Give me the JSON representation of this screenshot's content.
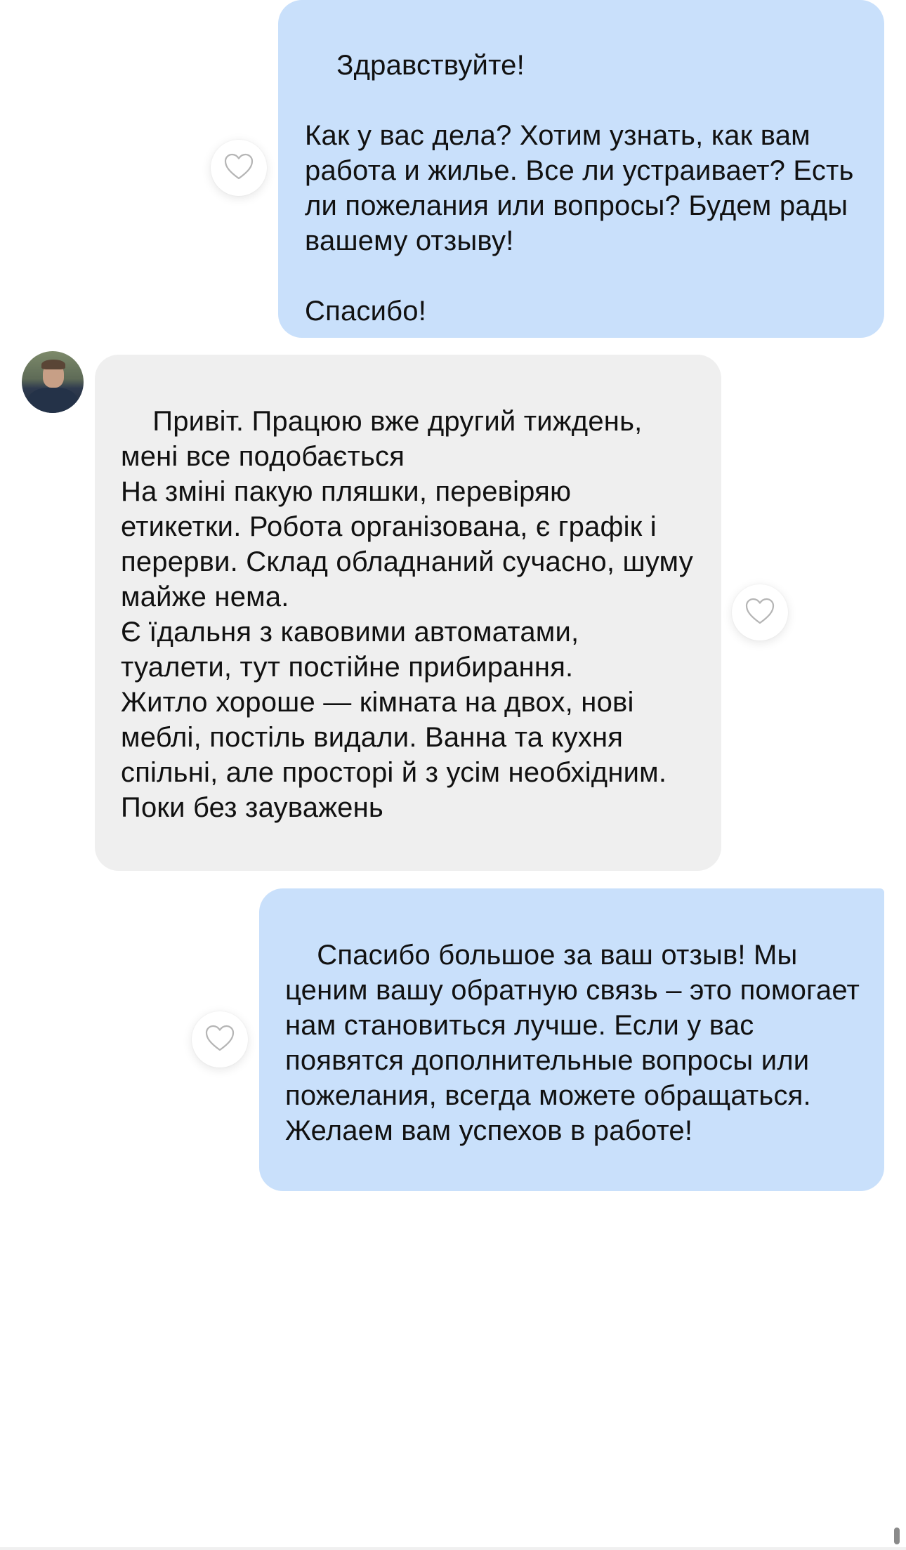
{
  "messages": [
    {
      "id": "msg1",
      "direction": "outgoing",
      "text": "Здравствуйте!\n\nКак у вас дела? Хотим узнать, как вам работа и жилье. Все ли устраивает? Есть ли пожелания или вопросы? Будем рады вашему отзыву!\n\nСпасибо!"
    },
    {
      "id": "msg2",
      "direction": "incoming",
      "text": "Привіт. Працюю вже другий тиждень, мені все подобається\nНа зміні пакую пляшки, перевіряю етикетки. Робота організована, є графік і перерви. Склад обладнаний сучасно, шуму майже нема.\nЄ їдальня з кавовими автоматами, туалети, тут постійне прибирання.\nЖитло хороше — кімната на двох, нові меблі, постіль видали. Ванна та кухня спільні, але просторі й з усім необхідним.\nПоки без зауважень"
    },
    {
      "id": "msg3",
      "direction": "outgoing",
      "text": "Спасибо большое за ваш отзыв! Мы ценим вашу обратную связь – это помогает нам становиться лучше. Если у вас появятся дополнительные вопросы или пожелания, всегда можете обращаться. Желаем вам успехов в работе!"
    }
  ],
  "icons": {
    "like": "heart-outline-icon",
    "avatar": "user-avatar"
  },
  "colors": {
    "outgoing_bubble": "#c9e0fb",
    "incoming_bubble": "#efefef",
    "text": "#111111",
    "heart_stroke": "#b5b5b5"
  }
}
